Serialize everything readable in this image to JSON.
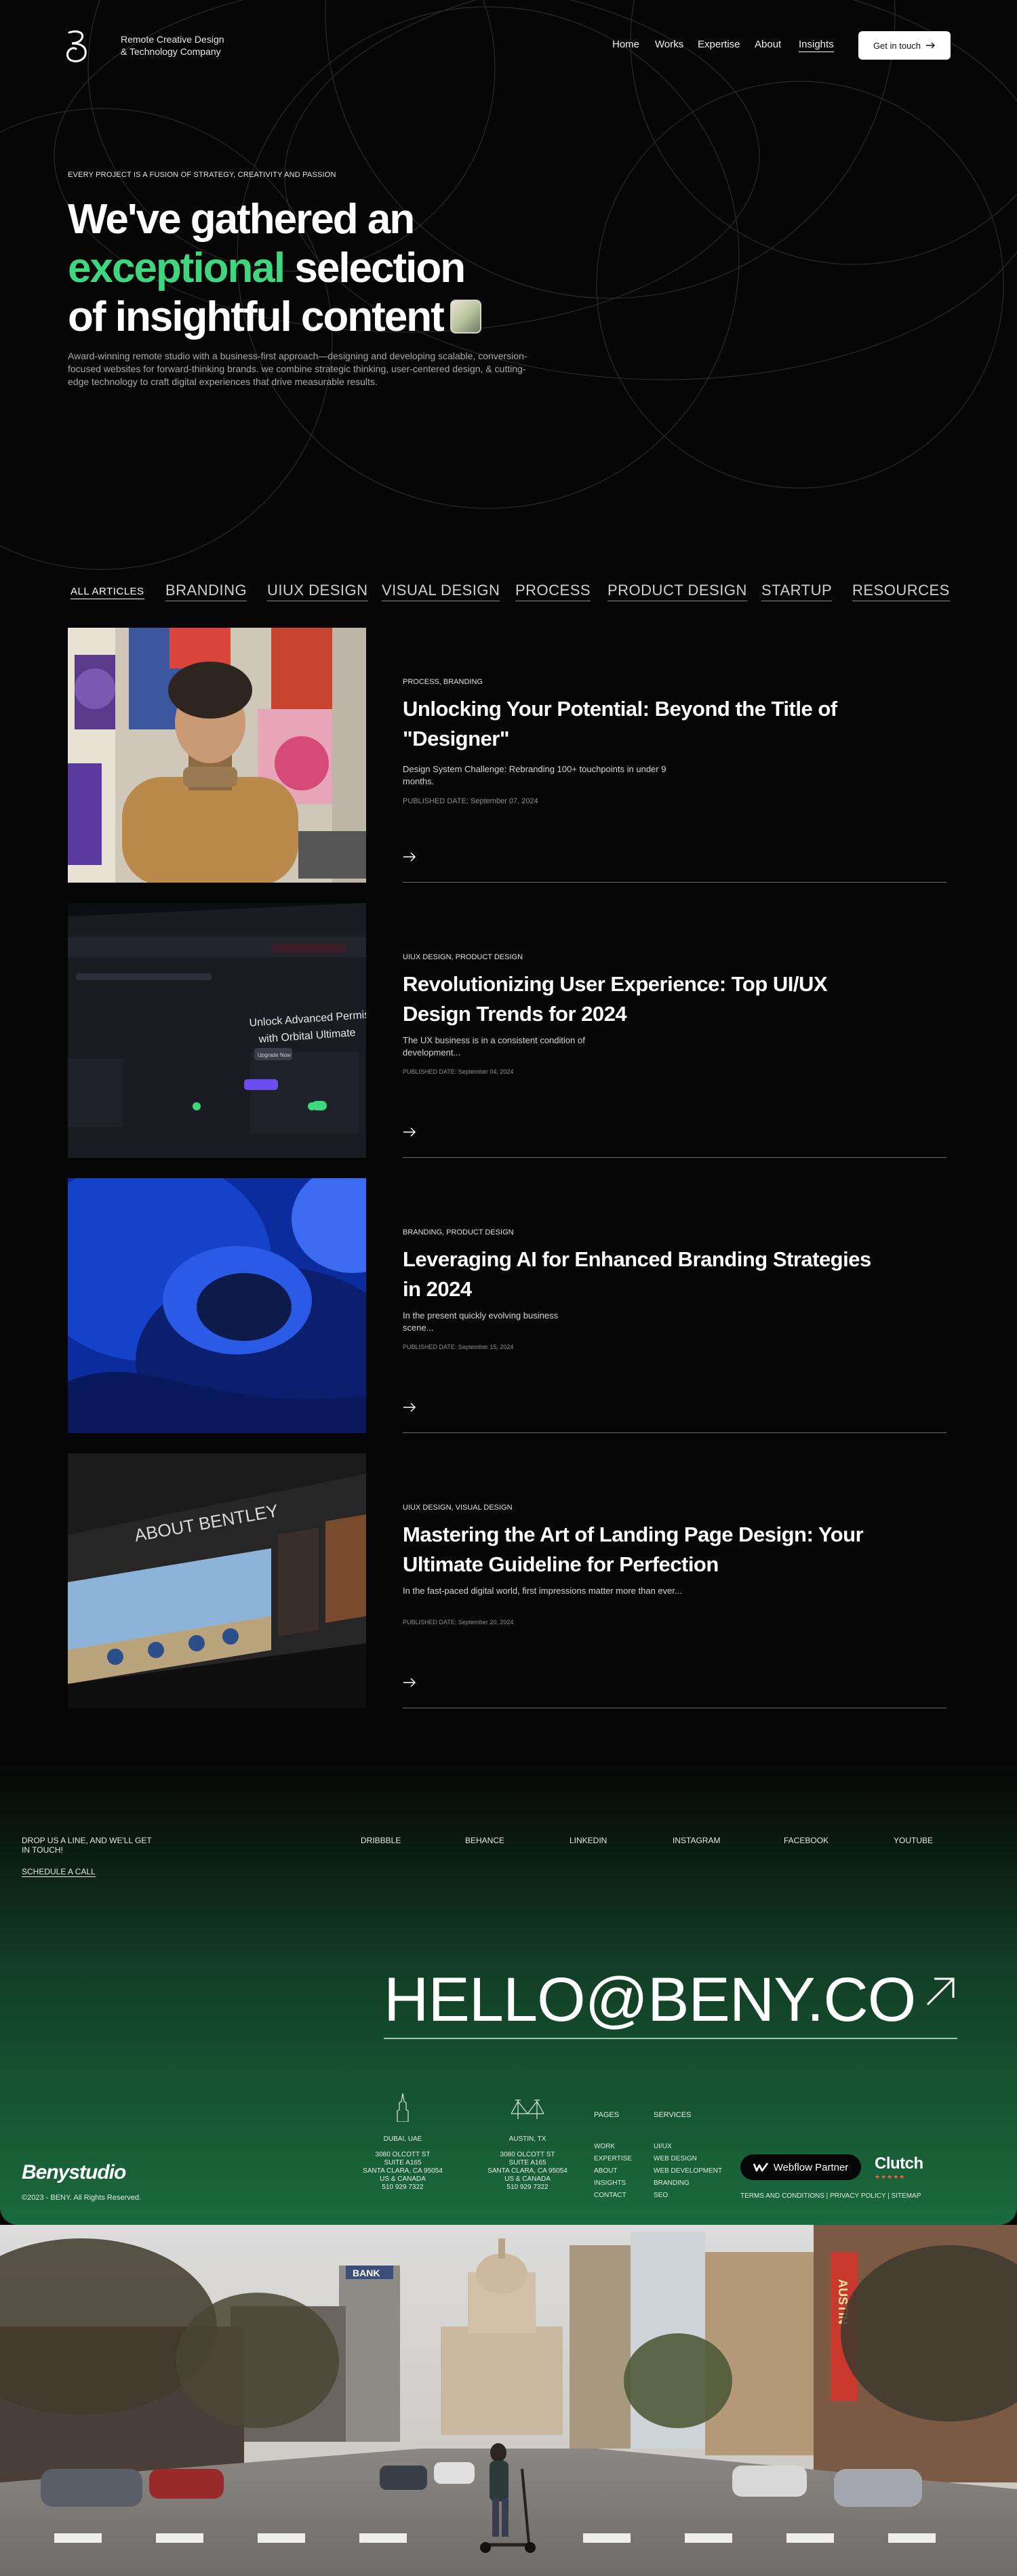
{
  "header": {
    "tagline_line1": "Remote Creative Design",
    "tagline_line2": "& Technology Company",
    "nav": [
      {
        "label": "Home"
      },
      {
        "label": "Works"
      },
      {
        "label": "Expertise"
      },
      {
        "label": "About"
      },
      {
        "label": "Insights",
        "active": true
      }
    ],
    "cta_label": "Get in touch",
    "cta_icon": "arrow-right-icon"
  },
  "hero": {
    "eyebrow": "EVERY PROJECT IS A FUSION OF STRATEGY, CREATIVITY AND PASSION",
    "title_line1": "We've gathered an",
    "title_accent": "exceptional",
    "title_line2_rest": " selection",
    "title_line3": "of insightful content",
    "accent_color": "#3fd77e",
    "description": "Award-winning remote studio with a business-first approach—designing and developing scalable, conversion-focused websites for forward-thinking brands. we combine strategic thinking, user-centered design, & cutting-edge technology to craft digital experiences that drive measurable results."
  },
  "filters": [
    {
      "label": "ALL ARTICLES",
      "active": true
    },
    {
      "label": "BRANDING"
    },
    {
      "label": "UIUX DESIGN"
    },
    {
      "label": "VISUAL DESIGN"
    },
    {
      "label": "PROCESS"
    },
    {
      "label": "PRODUCT DESIGN"
    },
    {
      "label": "STARTUP"
    },
    {
      "label": "RESOURCES"
    }
  ],
  "articles": [
    {
      "categories": "PROCESS, BRANDING",
      "title": "Unlocking Your Potential: Beyond the Title of \"Designer\"",
      "excerpt": "Design System Challenge: Rebranding 100+ touchpoints in under 9 months.",
      "date": "PUBLISHED DATE: September 07, 2024"
    },
    {
      "categories": "UIUX DESIGN, PRODUCT DESIGN",
      "title": "Revolutionizing User Experience: Top UI/UX Design Trends for 2024",
      "excerpt": "The UX business is in a consistent condition of development...",
      "date": "PUBLISHED DATE: September 04, 2024",
      "image_text_1": "Unlock Advanced Permissions",
      "image_text_2": "with Orbital Ultimate",
      "image_button": "Upgrade Now"
    },
    {
      "categories": "BRANDING, PRODUCT DESIGN",
      "title": "Leveraging AI for Enhanced Branding Strategies in 2024",
      "excerpt": "In the present quickly evolving business scene...",
      "date": "PUBLISHED DATE: September 15, 2024"
    },
    {
      "categories": "UIUX DESIGN, VISUAL DESIGN",
      "title": "Mastering the Art of Landing Page Design: Your Ultimate Guideline for Perfection",
      "excerpt": "In the fast-paced digital world, first impressions matter more than ever...",
      "date": "PUBLISHED DATE: September 20, 2024",
      "image_text": "ABOUT BENTLEY"
    }
  ],
  "footer": {
    "drop_line": "DROP US A LINE, AND WE'LL GET IN TOUCH!",
    "schedule_label": "SCHEDULE A CALL",
    "socials": [
      "DRIBBBLE",
      "BEHANCE",
      "LINKEDIN",
      "INSTAGRAM",
      "FACEBOOK",
      "YOUTUBE"
    ],
    "email": "HELLO@BENY.CO",
    "logo_text": "Benystudio",
    "copyright": "©2023 - BENY. All Rights Reserved.",
    "offices": [
      {
        "city": "DUBAI, UAE",
        "icon": "burj-tower-icon",
        "address": [
          "3080 OLCOTT ST",
          "SUITE A165",
          "SANTA CLARA, CA 95054",
          "US & CANADA",
          "510 929 7322"
        ]
      },
      {
        "city": "AUSTIN, TX",
        "icon": "bridge-icon",
        "address": [
          "3080 OLCOTT ST",
          "SUITE A165",
          "SANTA CLARA, CA 95054",
          "US & CANADA",
          "510 929 7322"
        ]
      }
    ],
    "pages_heading": "PAGES",
    "pages": [
      "WORK",
      "EXPERTISE",
      "ABOUT",
      "INSIGHTS",
      "CONTACT"
    ],
    "services_heading": "SERVICES",
    "services": [
      "UI/UX",
      "WEB DESIGN",
      "WEB DEVELOPMENT",
      "BRANDING",
      "SEO"
    ],
    "webflow_label": "Webflow Partner",
    "clutch_label": "Clutch",
    "clutch_stars": "★★★★★",
    "legal": [
      "TERMS AND CONDITIONS",
      "PRIVACY POLICY",
      "SITEMAP"
    ]
  },
  "bottom_image": {
    "sign_bank": "BANK",
    "sign_neon": "AUSTIN"
  }
}
